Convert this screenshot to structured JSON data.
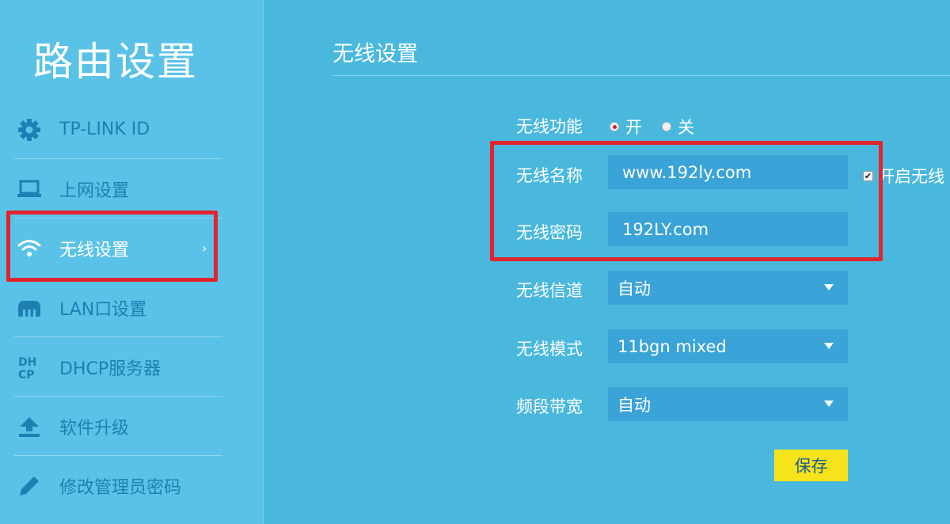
{
  "brand": "路由设置",
  "sidebar": {
    "items": [
      {
        "label": "TP-LINK ID",
        "icon": "gear-icon"
      },
      {
        "label": "上网设置",
        "icon": "laptop-icon"
      },
      {
        "label": "无线设置",
        "icon": "wifi-icon",
        "active": true
      },
      {
        "label": "LAN口设置",
        "icon": "lan-icon"
      },
      {
        "label": "DHCP服务器",
        "icon": "dhcp-icon"
      },
      {
        "label": "软件升级",
        "icon": "upload-icon"
      },
      {
        "label": "修改管理员密码",
        "icon": "pencil-icon"
      }
    ],
    "chevron": "›"
  },
  "main": {
    "title": "无线设置",
    "wireless_func": {
      "label": "无线功能",
      "on": "开",
      "off": "关",
      "selected": "开"
    },
    "ssid": {
      "label": "无线名称",
      "value": "www.192ly.com"
    },
    "ssid_checkbox": {
      "label": "开启无线"
    },
    "password": {
      "label": "无线密码",
      "value": "192LY.com"
    },
    "channel": {
      "label": "无线信道",
      "value": "自动"
    },
    "mode": {
      "label": "无线模式",
      "value": "11bgn mixed"
    },
    "bandwidth": {
      "label": "频段带宽",
      "value": "自动"
    },
    "save": "保存"
  },
  "colors": {
    "background": "#4ab8dd",
    "sidebar": "#5ac2e6",
    "field": "#3aa3d8",
    "highlight": "#e3232d",
    "save_button": "#f7e31b"
  }
}
